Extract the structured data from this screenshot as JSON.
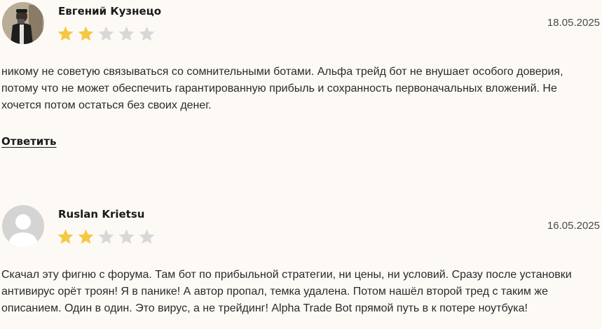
{
  "reviews": [
    {
      "author": "Евгений Кузнецо",
      "rating": 2,
      "max_rating": 5,
      "date": "18.05.2025",
      "avatar": "user-photo",
      "text": "никому не советую связываться со сомнительными ботами. Альфа трейд бот не внушает особого доверия, потому что не может обеспечить гарантированную прибыль и сохранность первоначальных вложений. Не хочется потом остаться без своих денег.",
      "reply_label": "Ответить"
    },
    {
      "author": "Ruslan Krietsu",
      "rating": 2,
      "max_rating": 5,
      "date": "16.05.2025",
      "avatar": "default-avatar-icon",
      "text": "Скачал эту фигню с форума. Там бот по прибыльной стратегии, ни цены, ни условий. Сразу после установки антивирус орёт троян! Я в панике! А автор пропал, темка удалена. Потом нашёл второй тред с таким же описанием. Один в один. Это вирус, а не трейдинг! Alpha Trade Bot прямой путь в к потере ноутбука!"
    }
  ],
  "colors": {
    "star_filled": "#f5c842",
    "star_empty": "#d8d8d8",
    "background": "#fdfaf6"
  }
}
